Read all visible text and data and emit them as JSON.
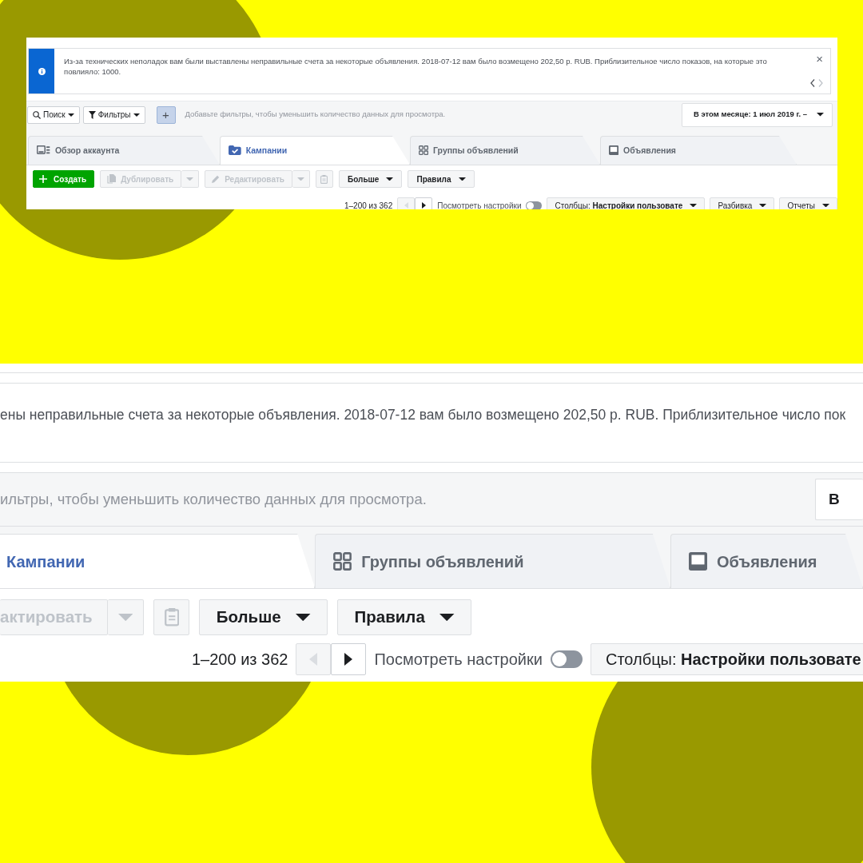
{
  "top_view": {
    "notice": {
      "text": "Из-за технических неполадок вам были выставлены неправильные счета за некоторые объявления. 2018-07-12 вам было возмещено 202,50 р. RUB. Приблизительное число показов, на которые это повлияло: 1000.",
      "close": "×"
    },
    "filter_bar": {
      "search": "Поиск",
      "filters": "Фильтры",
      "add": "+",
      "hint": "Добавьте фильтры, чтобы уменьшить количество данных для просмотра.",
      "date": "В этом месяце: 1 июл 2019 г. –"
    },
    "tabs": [
      {
        "label": "Обзор аккаунта",
        "selected": false
      },
      {
        "label": "Кампании",
        "selected": true
      },
      {
        "label": "Группы объявлений",
        "selected": false
      },
      {
        "label": "Объявления",
        "selected": false
      }
    ],
    "toolbar": [
      {
        "kind": "create",
        "label": "Создать",
        "disabled": false
      },
      {
        "kind": "split",
        "label": "Дублировать",
        "disabled": true
      },
      {
        "kind": "split",
        "label": "Редактировать",
        "disabled": true
      },
      {
        "kind": "clipboard",
        "disabled": true
      },
      {
        "kind": "dropdown",
        "label": "Больше",
        "disabled": false
      },
      {
        "kind": "dropdown",
        "label": "Правила",
        "disabled": false
      }
    ],
    "pager": {
      "range": "1–200 из 362",
      "prev_disabled": true,
      "view_settings": "Посмотреть настройки",
      "toggle_on": false,
      "columns": "Столбцы: **Настройки пользовате**",
      "breakdown": "Разбивка",
      "reports": "Отчеты"
    }
  },
  "zoomed_view": {
    "notice_text": "ены неправильные счета за некоторые объявления. 2018-07-12 вам было возмещено 202,50 р. RUB. Приблизительное число пок",
    "filter_hint": "ильтры, чтобы уменьшить количество данных для просмотра.",
    "date": "В",
    "tabs": [
      {
        "label": "Кампании",
        "selected": true
      },
      {
        "label": "Группы объявлений",
        "selected": false
      },
      {
        "label": "Объявления",
        "selected": false
      }
    ],
    "toolbar": [
      {
        "kind": "split",
        "label": "актировать",
        "disabled": true
      },
      {
        "kind": "clipboard",
        "disabled": true
      },
      {
        "kind": "dropdown",
        "label": "Больше",
        "disabled": false
      },
      {
        "kind": "dropdown",
        "label": "Правила",
        "disabled": false
      }
    ],
    "pager": {
      "range": "1–200 из 362",
      "prev_disabled": true,
      "view_settings": "Посмотреть настройки",
      "toggle_on": false,
      "columns": "Столбцы: **Настройки пользовате**"
    }
  }
}
